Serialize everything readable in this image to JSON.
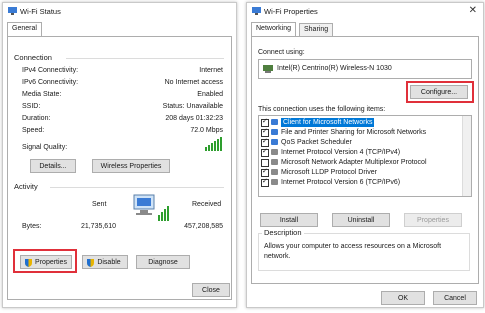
{
  "status_window": {
    "title": "Wi-Fi Status",
    "tab": "General",
    "connection": {
      "label": "Connection",
      "rows": [
        {
          "k": "IPv4 Connectivity:",
          "v": "Internet"
        },
        {
          "k": "IPv6 Connectivity:",
          "v": "No Internet access"
        },
        {
          "k": "Media State:",
          "v": "Enabled"
        },
        {
          "k": "SSID:",
          "v": "Status: Unavailable"
        },
        {
          "k": "Duration:",
          "v": "208 days 01:32:23"
        },
        {
          "k": "Speed:",
          "v": "72.0 Mbps"
        }
      ],
      "signal_label": "Signal Quality:",
      "details_btn": "Details...",
      "wireless_btn": "Wireless Properties"
    },
    "activity": {
      "label": "Activity",
      "sent": "Sent",
      "received": "Received",
      "bytes_label": "Bytes:",
      "sent_value": "21,735,610",
      "received_value": "457,208,585"
    },
    "buttons": {
      "properties": "Properties",
      "disable": "Disable",
      "diagnose": "Diagnose",
      "close": "Close"
    }
  },
  "props_window": {
    "title": "Wi-Fi Properties",
    "tabs": [
      "Networking",
      "Sharing"
    ],
    "connect_using_label": "Connect using:",
    "adapter": "Intel(R) Centrino(R) Wireless-N 1030",
    "configure_btn": "Configure...",
    "items_label": "This connection uses the following items:",
    "items": [
      {
        "label": "Client for Microsoft Networks",
        "checked": true
      },
      {
        "label": "File and Printer Sharing for Microsoft Networks",
        "checked": true
      },
      {
        "label": "QoS Packet Scheduler",
        "checked": true
      },
      {
        "label": "Internet Protocol Version 4 (TCP/IPv4)",
        "checked": true
      },
      {
        "label": "Microsoft Network Adapter Multiplexor Protocol",
        "checked": false
      },
      {
        "label": "Microsoft LLDP Protocol Driver",
        "checked": true
      },
      {
        "label": "Internet Protocol Version 6 (TCP/IPv6)",
        "checked": true
      }
    ],
    "install_btn": "Install",
    "uninstall_btn": "Uninstall",
    "properties_btn": "Properties",
    "description_label": "Description",
    "description_text": "Allows your computer to access resources on a Microsoft network.",
    "ok_btn": "OK",
    "cancel_btn": "Cancel"
  },
  "colors": {
    "highlight": "#e0303a",
    "selection": "#0078d7",
    "signal": "#2e9e2e"
  }
}
